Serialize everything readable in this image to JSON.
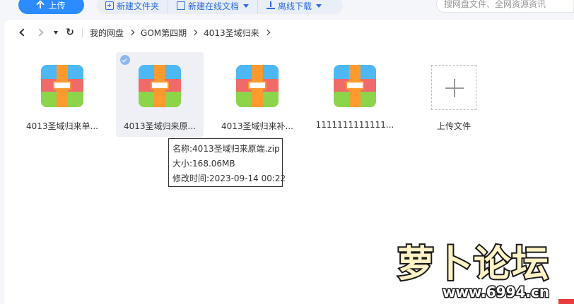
{
  "toolbar": {
    "upload_label": "上传",
    "new_folder_label": "新建文件夹",
    "new_online_doc_label": "新建在线文档",
    "offline_download_label": "离线下载"
  },
  "search": {
    "placeholder": "搜网盘文件、全网资源资讯"
  },
  "breadcrumb": {
    "items": [
      "我的网盘",
      "GOM第四期",
      "4013圣域归来"
    ]
  },
  "files": [
    {
      "name": "4013圣域归来单...",
      "selected": false
    },
    {
      "name": "4013圣域归来原...",
      "selected": true
    },
    {
      "name": "4013圣域归来补...",
      "selected": false
    },
    {
      "name": "1111111111111...",
      "selected": false
    }
  ],
  "upload_tile": {
    "label": "上传文件"
  },
  "tooltip": {
    "name_line": "名称:4013圣域归来原端.zip",
    "size_line": "大小:168.06MB",
    "modified_line": "修改时间:2023-09-14 00:22"
  },
  "watermark": {
    "logo_text": "萝卜论坛",
    "url": "www.6994.cn"
  },
  "colors": {
    "accent": "#2b8bff",
    "zip_blue": "#4db8f5",
    "zip_red": "#f06a6a",
    "zip_green": "#8cd44a",
    "zip_orange": "#ff9a2e"
  }
}
